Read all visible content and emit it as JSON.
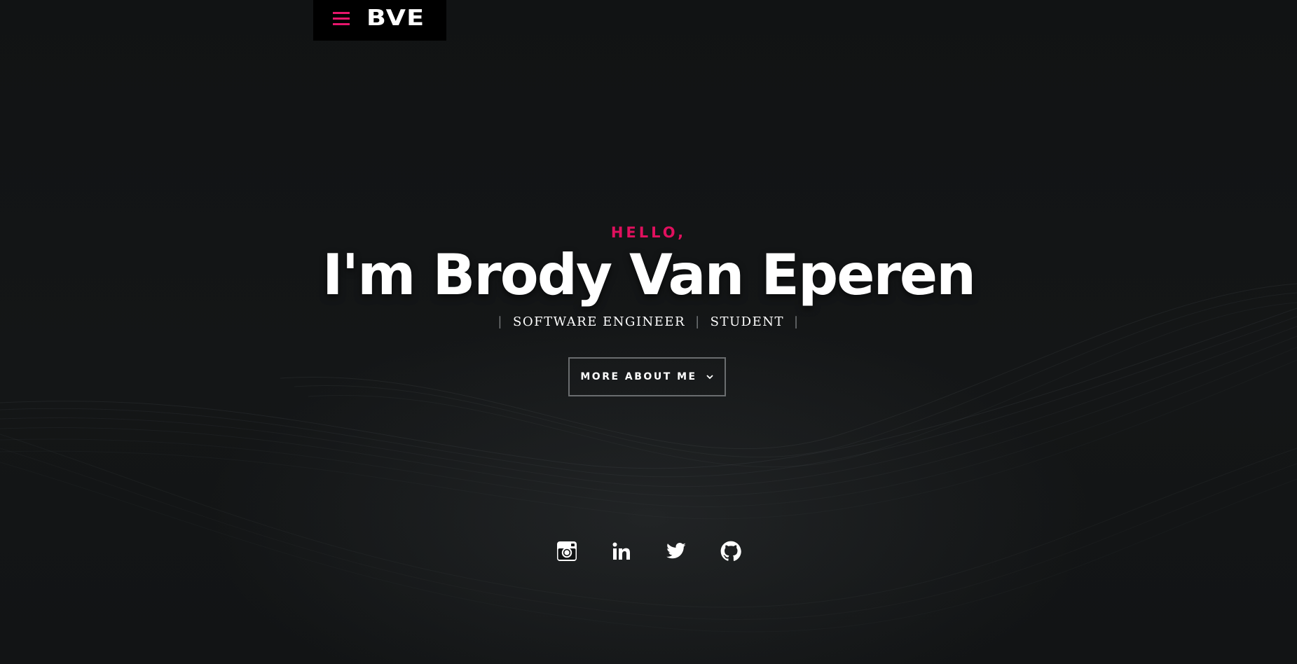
{
  "header": {
    "logo_text": "BVE",
    "menu_icon": "hamburger-menu-icon",
    "accent_color": "#e6166b"
  },
  "hero": {
    "greeting": "HELLO,",
    "name": "I'm Brody Van Eperen",
    "roles": [
      "SOFTWARE ENGINEER",
      "STUDENT"
    ],
    "role_separator": "|",
    "cta_label": "MORE ABOUT ME",
    "cta_icon": "chevron-down-icon"
  },
  "social": {
    "links": [
      {
        "name": "Instagram",
        "icon": "instagram-icon"
      },
      {
        "name": "LinkedIn",
        "icon": "linkedin-icon"
      },
      {
        "name": "Twitter",
        "icon": "twitter-icon"
      },
      {
        "name": "GitHub",
        "icon": "github-icon"
      }
    ]
  },
  "colors": {
    "background": "#111314",
    "text": "#ffffff",
    "accent": "#e0105e",
    "button_border": "#6a6d6f"
  }
}
